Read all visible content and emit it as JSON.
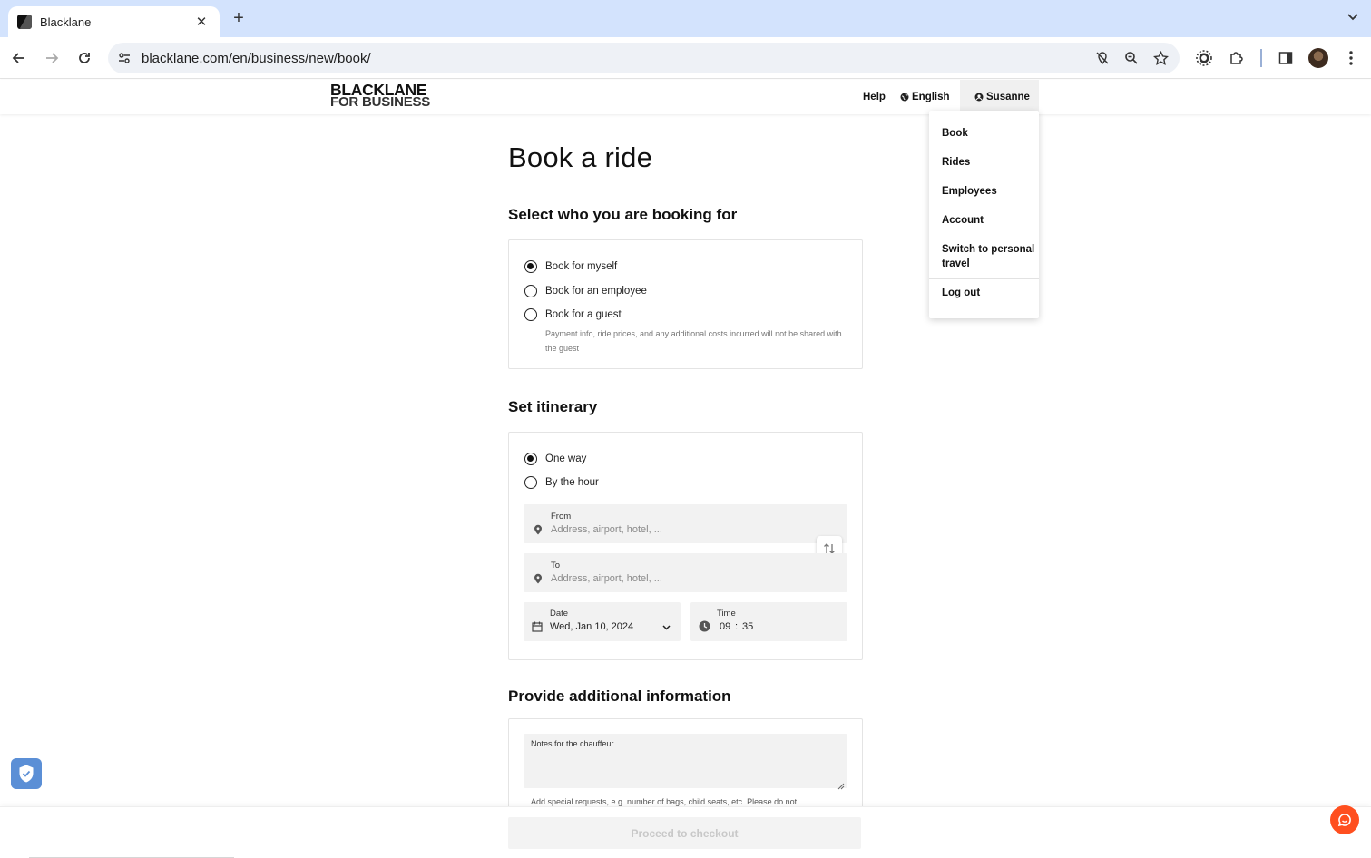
{
  "browser": {
    "tab_title": "Blacklane",
    "url": "blacklane.com/en/business/new/book/"
  },
  "header": {
    "logo_line1": "BLACKLANE",
    "logo_line2": "FOR BUSINESS",
    "help": "Help",
    "language": "English",
    "user": "Susanne"
  },
  "user_menu": {
    "items": [
      "Book",
      "Rides",
      "Employees",
      "Account",
      "Switch to personal",
      "travel",
      "Log out"
    ]
  },
  "booking_for": {
    "title": "Select who you are booking for",
    "options": [
      "Book for myself",
      "Book for an employee",
      "Book for a guest"
    ],
    "selected": "Book for myself",
    "guest_help": "Payment info, ride prices, and any additional costs incurred will not be shared with the guest"
  },
  "page": {
    "title": "Book a ride"
  },
  "itinerary": {
    "title": "Set itinerary",
    "options": [
      "One way",
      "By the hour"
    ],
    "selected": "One way",
    "from_label": "From",
    "from_placeholder": "Address, airport, hotel, ...",
    "to_label": "To",
    "to_placeholder": "Address, airport, hotel, ...",
    "date_label": "Date",
    "date_value": "Wed, Jan 10, 2024",
    "time_label": "Time",
    "time_hours": "09",
    "time_sep": ":",
    "time_minutes": "35"
  },
  "additional": {
    "title": "Provide additional information",
    "notes_placeholder": "Notes for the chauffeur",
    "notes_help": "Add special requests, e.g. number of bags, child seats, etc. Please do not"
  },
  "footer": {
    "checkout": "Proceed to checkout"
  },
  "colors": {
    "tabstrip": "#d3e3fd",
    "chat": "#ff4f1f",
    "shield": "#5b8fd6"
  }
}
